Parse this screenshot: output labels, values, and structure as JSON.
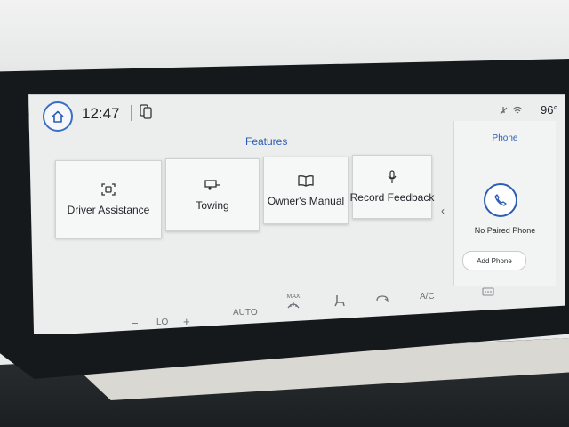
{
  "status_bar": {
    "time": "12:47",
    "temperature": "96°"
  },
  "features": {
    "title": "Features",
    "tiles": [
      {
        "label": "Driver Assistance",
        "icon": "driver-assist-icon"
      },
      {
        "label": "Towing",
        "icon": "trailer-icon"
      },
      {
        "label": "Owner's Manual",
        "icon": "book-icon"
      },
      {
        "label": "Record Feedback",
        "icon": "microphone-icon"
      }
    ],
    "more_chevron": "‹"
  },
  "phone": {
    "title": "Phone",
    "status": "No Paired Phone",
    "add_button": "Add Phone"
  },
  "climate": {
    "minus": "−",
    "fan_level": "LO",
    "plus": "+",
    "auto": "AUTO",
    "max": "MAX",
    "ac": "A/C"
  },
  "colors": {
    "accent": "#2d5cb4",
    "screen_bg": "#eceded",
    "bezel": "#16191b"
  }
}
